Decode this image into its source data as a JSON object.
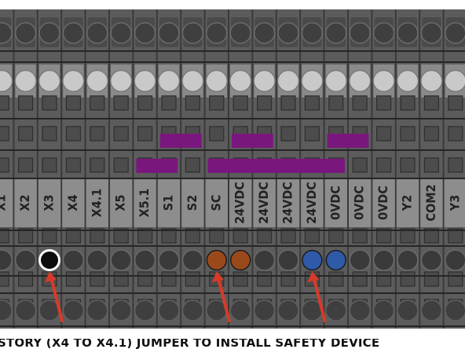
{
  "figure": {
    "terminal_labels": [
      "X1",
      "X2",
      "X3",
      "X4",
      "X4.1",
      "X5",
      "X5.1",
      "S1",
      "S2",
      "SC",
      "24VDC",
      "24VDC",
      "24VDC",
      "24VDC",
      "0VDC",
      "0VDC",
      "0VDC",
      "Y2",
      "COM2",
      "Y3"
    ],
    "jumpers_top_row": [
      {
        "from": 7,
        "to": 8
      },
      {
        "from": 10,
        "to": 11
      },
      {
        "from": 14,
        "to": 15
      }
    ],
    "jumpers_bottom_row": [
      {
        "from": 6,
        "to": 7
      },
      {
        "from": 9,
        "to": 14
      }
    ],
    "highlighted_holes": [
      {
        "column": 2,
        "color": "black"
      },
      {
        "column": 9,
        "color": "brown"
      },
      {
        "column": 10,
        "color": "brown"
      },
      {
        "column": 13,
        "color": "blue"
      },
      {
        "column": 14,
        "color": "blue"
      }
    ],
    "arrow_targets": [
      2,
      9,
      13
    ],
    "colors": {
      "terminal": "#5c5c5c",
      "terminal_dark": "#3a3a3a",
      "label_band": "#8d8d8d",
      "jumper": "#7a177e",
      "arrow": "#d63b2a",
      "black_wire": "#0d0d0d",
      "brown_wire": "#9a4a1a",
      "blue_wire": "#2e5aa8"
    }
  },
  "caption": "STORY (X4 TO X4.1) JUMPER TO INSTALL SAFETY DEVICE"
}
